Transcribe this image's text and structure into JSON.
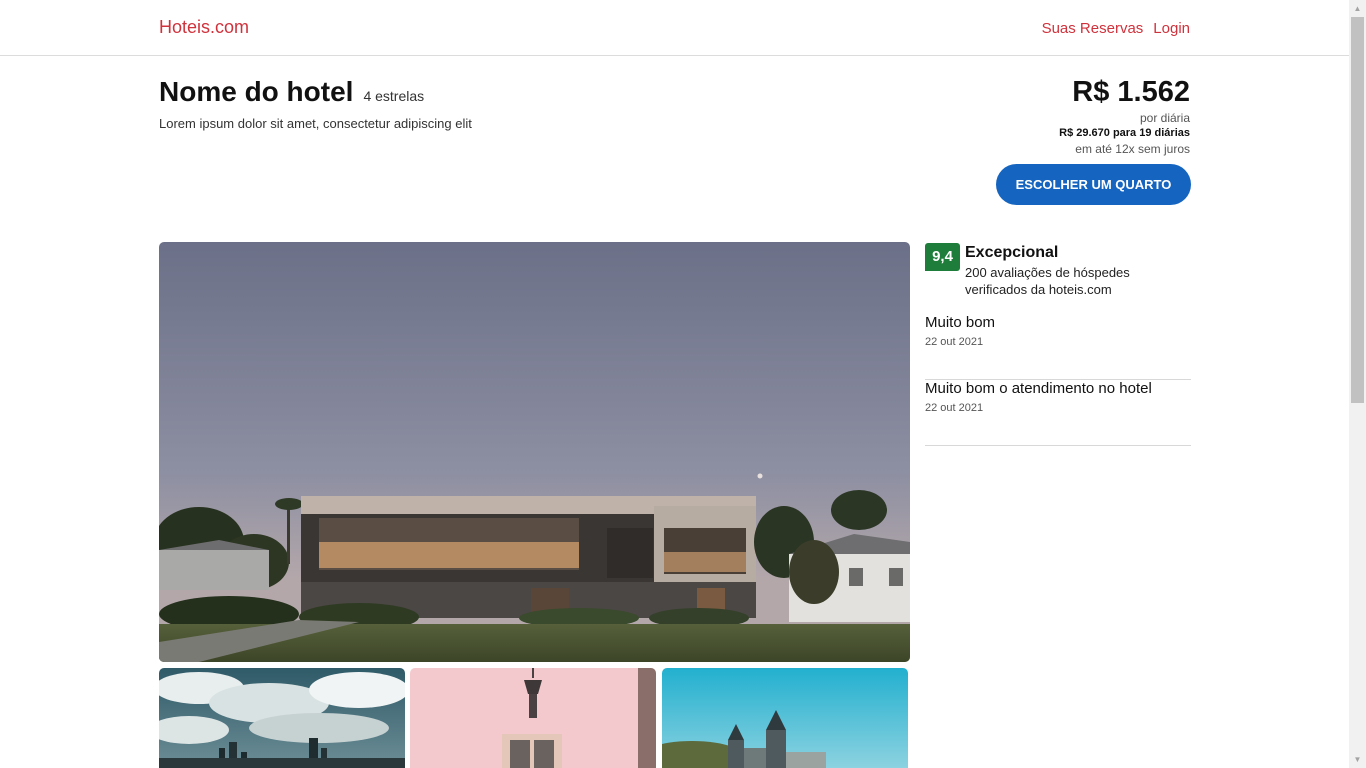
{
  "brand": "Hoteis.com",
  "nav": {
    "reservations": "Suas Reservas",
    "login": "Login"
  },
  "hotel": {
    "name": "Nome do hotel",
    "stars": "4 estrelas",
    "description": "Lorem ipsum dolor sit amet, consectetur adipiscing elit"
  },
  "pricing": {
    "price": "R$ 1.562",
    "per_night": "por diária",
    "total": "R$ 29.670 para 19 diárias",
    "installments": "em até 12x sem juros",
    "cta": "ESCOLHER UM QUARTO"
  },
  "rating": {
    "score": "9,4",
    "label": "Excepcional",
    "count": "200 avaliações de hóspedes verificados da hoteis.com"
  },
  "reviews": [
    {
      "title": "Muito bom",
      "date": "22 out 2021"
    },
    {
      "title": "Muito bom o atendimento no hotel",
      "date": "22 out 2021"
    }
  ],
  "colors": {
    "brand": "#d0323c",
    "cta": "#1565c0",
    "score": "#1e7d3a"
  }
}
